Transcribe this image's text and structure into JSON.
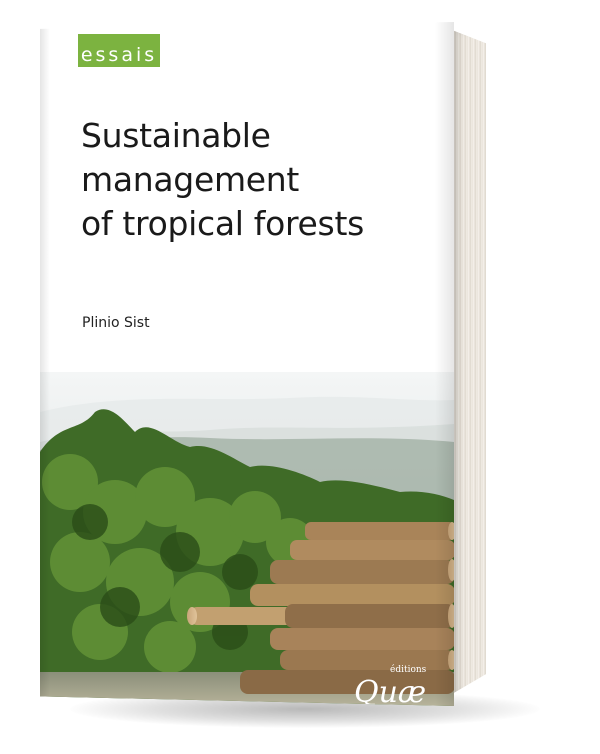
{
  "book": {
    "series_label": "essais",
    "title_lines": [
      "Sustainable",
      "management",
      "of tropical forests"
    ],
    "author": "Plinio Sist",
    "publisher": {
      "small": "éditions",
      "large": "Quæ"
    },
    "colors": {
      "series_badge": "#7cb340",
      "title_text": "#1a1a1a",
      "cover_background": "#ffffff",
      "forest_dark": "#2f5a1e",
      "forest_light": "#6f9a3a",
      "mist": "#dfe4e4",
      "logs": "#a98459"
    },
    "cover_image": "tropical-forest-with-log-pile"
  }
}
